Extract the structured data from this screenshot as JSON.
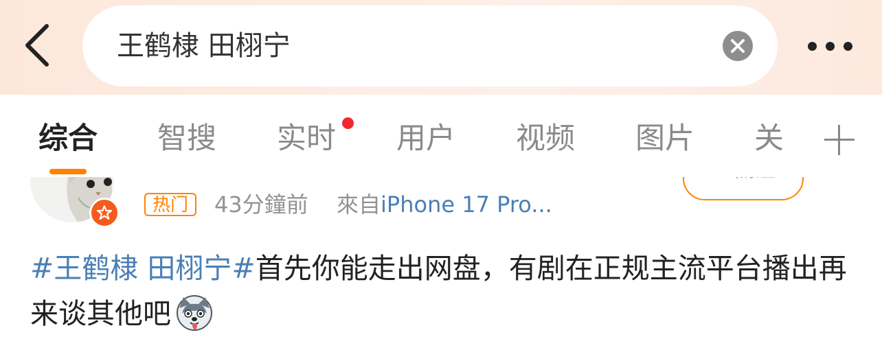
{
  "header": {
    "search_query": "王鹤棣 田栩宁"
  },
  "tabs": [
    {
      "label": "综合",
      "active": true
    },
    {
      "label": "智搜"
    },
    {
      "label": "实时",
      "has_dot": true
    },
    {
      "label": "用户"
    },
    {
      "label": "视频"
    },
    {
      "label": "图片"
    },
    {
      "label": "关"
    }
  ],
  "post": {
    "follow_label": "+ 關注",
    "hot_tag": "热门",
    "time": "43分鐘前",
    "from_prefix": "來自",
    "device": "iPhone 17 Pro...",
    "topic": "#王鹤棣 田栩宁#",
    "text": "首先你能走出网盘，有剧在正规主流平台播出再来谈其他吧"
  },
  "colors": {
    "accent": "#ff8200",
    "link": "#4a7fb5",
    "dot": "#f0282d"
  }
}
